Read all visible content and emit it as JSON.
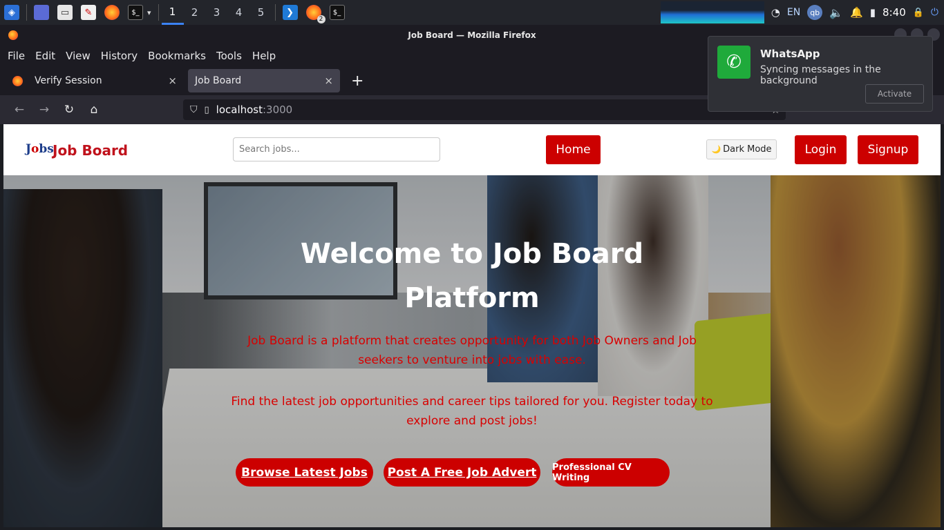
{
  "taskbar": {
    "workspaces": [
      "1",
      "2",
      "3",
      "4",
      "5"
    ],
    "badge": "2",
    "lang": "EN",
    "qb": "qb",
    "clock": "8:40"
  },
  "window": {
    "title": "Job Board — Mozilla Firefox"
  },
  "menu": [
    "File",
    "Edit",
    "View",
    "History",
    "Bookmarks",
    "Tools",
    "Help"
  ],
  "tabs": [
    {
      "label": "Verify Session",
      "close": "×"
    },
    {
      "label": "Job Board",
      "close": "×"
    }
  ],
  "newtab": "+",
  "url": {
    "host": "localhost",
    "port": ":3000"
  },
  "notification": {
    "app": "WhatsApp",
    "body": "Syncing messages in the background",
    "action": "Activate"
  },
  "site": {
    "logo_prefix": "J",
    "logo_mid": "o",
    "logo_suffix": "bs",
    "brand": "Job Board",
    "search_placeholder": "Search jobs...",
    "home": "Home",
    "dark_mode": "Dark Mode",
    "moon": "🌙",
    "login": "Login",
    "signup": "Signup"
  },
  "hero": {
    "title": "Welcome to Job Board Platform",
    "text1": "Job Board is a platform that creates opportunity for both Job Owners and Job seekers to venture into jobs with ease.",
    "text2": "Find the latest job opportunities and career tips tailored for you. Register today to explore and post jobs!",
    "btn_browse": "Browse Latest Jobs",
    "btn_post": "Post A Free Job Advert",
    "btn_cv": "Professional CV Writing"
  },
  "colors": {
    "brand_red": "#cc0000",
    "text_red": "#d80000"
  }
}
